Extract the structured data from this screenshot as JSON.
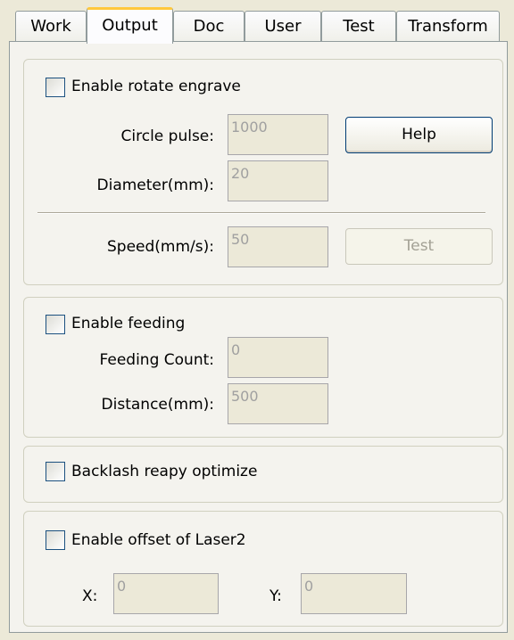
{
  "tabs": [
    {
      "label": "Work"
    },
    {
      "label": "Output"
    },
    {
      "label": "Doc"
    },
    {
      "label": "User"
    },
    {
      "label": "Test"
    },
    {
      "label": "Transform"
    }
  ],
  "active_tab": "Output",
  "rotate": {
    "checkbox_label": "Enable rotate engrave",
    "checked": false,
    "circle_pulse_label": "Circle pulse:",
    "circle_pulse_value": "1000",
    "diameter_label": "Diameter(mm):",
    "diameter_value": "20",
    "speed_label": "Speed(mm/s):",
    "speed_value": "50",
    "help_button": "Help",
    "test_button": "Test"
  },
  "feeding": {
    "checkbox_label": "Enable feeding",
    "checked": false,
    "count_label": "Feeding Count:",
    "count_value": "0",
    "distance_label": "Distance(mm):",
    "distance_value": "500"
  },
  "backlash": {
    "checkbox_label": "Backlash reapy optimize",
    "checked": false
  },
  "laser2": {
    "checkbox_label": "Enable offset of Laser2",
    "checked": false,
    "x_label": "X:",
    "x_value": "0",
    "y_label": "Y:",
    "y_value": "0"
  }
}
